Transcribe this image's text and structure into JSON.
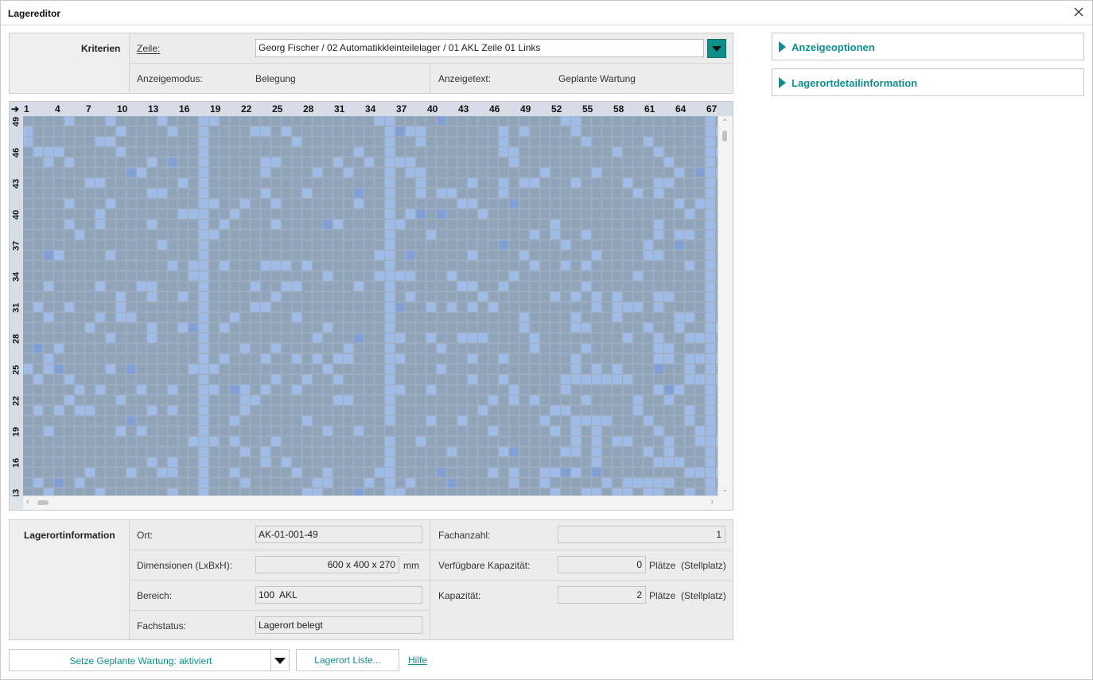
{
  "window": {
    "title": "Lagereditor"
  },
  "criteria": {
    "section_label": "Kriterien",
    "zeile_label": "Zeile:",
    "zeile_value": "Georg Fischer / 02 Automatikkleinteilelager / 01 AKL Zeile 01 Links",
    "anzeigemodus_label": "Anzeigemodus:",
    "anzeigemodus_value": "Belegung",
    "anzeigetext_label": "Anzeigetext:",
    "anzeigetext_value": "Geplante Wartung"
  },
  "grid": {
    "corner_icon": "arrow-right-icon",
    "columns": [
      "1",
      "4",
      "7",
      "10",
      "13",
      "16",
      "19",
      "22",
      "25",
      "28",
      "31",
      "34",
      "37",
      "40",
      "43",
      "46",
      "49",
      "52",
      "55",
      "58",
      "61",
      "64",
      "67"
    ],
    "rows": [
      "49",
      "46",
      "43",
      "40",
      "37",
      "34",
      "31",
      "28",
      "25",
      "22",
      "19",
      "16",
      "13"
    ],
    "colors": {
      "occupied": "#8fa3b9",
      "free": "#9fbce8",
      "maintenance": "#7f9fd6",
      "gridline": "#a9b6c6"
    }
  },
  "side": {
    "anzeigeoptionen": "Anzeigeoptionen",
    "lagerortdetail": "Lagerortdetailinformation"
  },
  "info": {
    "section_label": "Lagerortinformation",
    "ort_label": "Ort:",
    "ort_value": "AK-01-001-49",
    "dim_label": "Dimensionen (LxBxH):",
    "dim_value": "600 x 400 x 270",
    "dim_unit": "mm",
    "bereich_label": "Bereich:",
    "bereich_value": "100  AKL",
    "fachstatus_label": "Fachstatus:",
    "fachstatus_value": "Lagerort belegt",
    "fachanzahl_label": "Fachanzahl:",
    "fachanzahl_value": "1",
    "verf_label": "Verfügbare Kapazität:",
    "verf_value": "0",
    "verf_unit": "Plätze  (Stellplatz)",
    "kap_label": "Kapazität:",
    "kap_value": "2",
    "kap_unit": "Plätze  (Stellplatz)"
  },
  "footer": {
    "wartung_select": "Setze Geplante Wartung: aktiviert",
    "liste_button": "Lagerort Liste...",
    "hilfe_link": "Hilfe"
  },
  "accent": "#0f8f8c"
}
